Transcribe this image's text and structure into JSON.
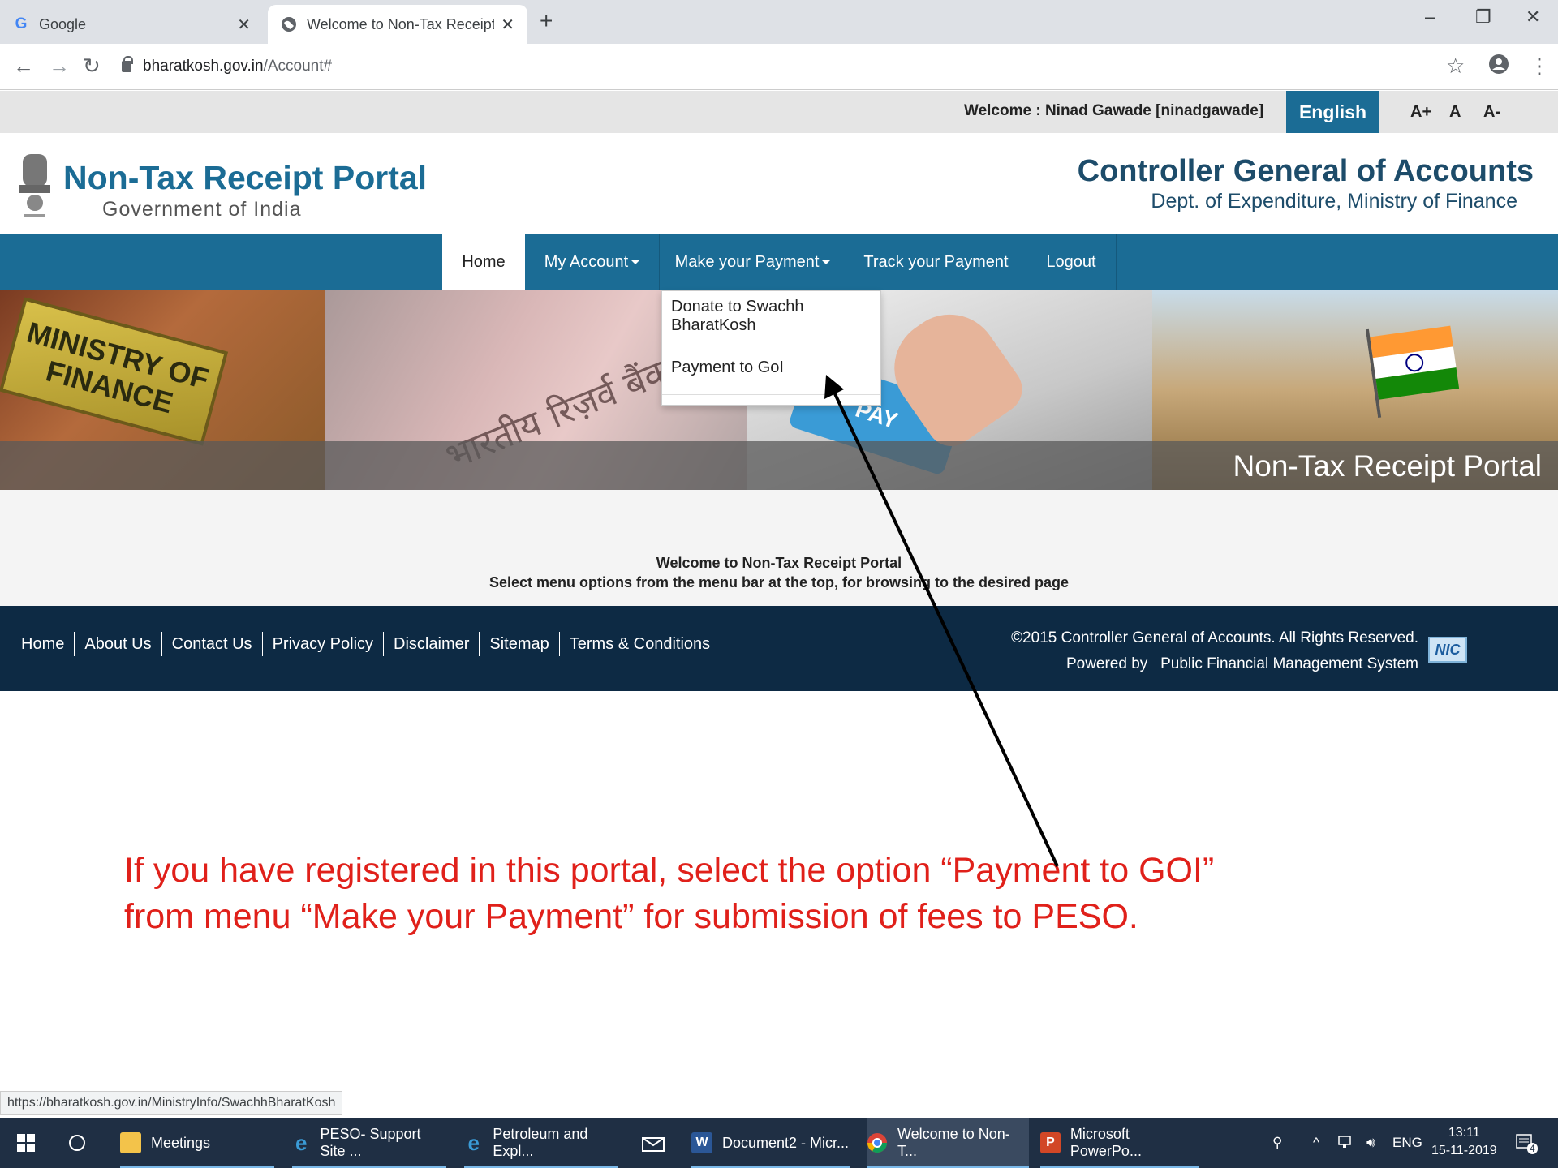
{
  "browser": {
    "tabs": [
      {
        "label": "Google"
      },
      {
        "label": "Welcome to Non-Tax Receipt Por"
      }
    ],
    "url_host": "bharatkosh.gov.in",
    "url_path": "/Account#"
  },
  "site": {
    "welcome_user": "Welcome : Ninad Gawade [ninadgawade]",
    "language": "English",
    "font_sizes": [
      "A+",
      "A",
      "A-"
    ],
    "portal_title": "Non-Tax Receipt Portal",
    "portal_subtitle": "Government of India",
    "cga_title": "Controller General of Accounts",
    "cga_subtitle": "Dept. of Expenditure, Ministry of Finance",
    "menu": [
      "Home",
      "My Account",
      "Make your Payment",
      "Track your Payment",
      "Logout"
    ],
    "dropdown": [
      "Donate to Swachh BharatKosh",
      "Payment to GoI"
    ],
    "banner_plate": [
      "MINISTRY OF",
      "FINANCE"
    ],
    "banner_note": "भारतीय रिज़र्व बैंक",
    "banner_key": "PAY",
    "banner_title": "Non-Tax Receipt Portal",
    "welcome_line1": "Welcome to Non-Tax Receipt Portal",
    "welcome_line2": "Select menu options from the menu bar at the top, for browsing to the desired page",
    "footer_links": [
      "Home",
      "About Us",
      "Contact Us",
      "Privacy Policy",
      "Disclaimer",
      "Sitemap",
      "Terms & Conditions"
    ],
    "footer_copy1": "©2015 Controller General of Accounts. All Rights Reserved.",
    "footer_copy2": "Powered by   Public Financial Management System",
    "nic_logo": "NIC"
  },
  "annotation": {
    "line1": "If you have registered in this portal, select the option “Payment to GOI”",
    "line2": "from menu “Make your Payment” for submission of fees to PESO."
  },
  "status_url": "https://bharatkosh.gov.in/MinistryInfo/SwachhBharatKosh",
  "taskbar": {
    "items": [
      "Meetings",
      "PESO- Support Site ...",
      "Petroleum and Expl...",
      "Document2 - Micr...",
      "Welcome to Non-T...",
      "Microsoft PowerPo..."
    ],
    "lang": "ENG",
    "time": "13:11",
    "date": "15-11-2019",
    "notifications": "4"
  },
  "colors": {
    "menu_blue": "#1b6c95",
    "footer_navy": "#0d2a44",
    "annotation_red": "#e0201a"
  }
}
